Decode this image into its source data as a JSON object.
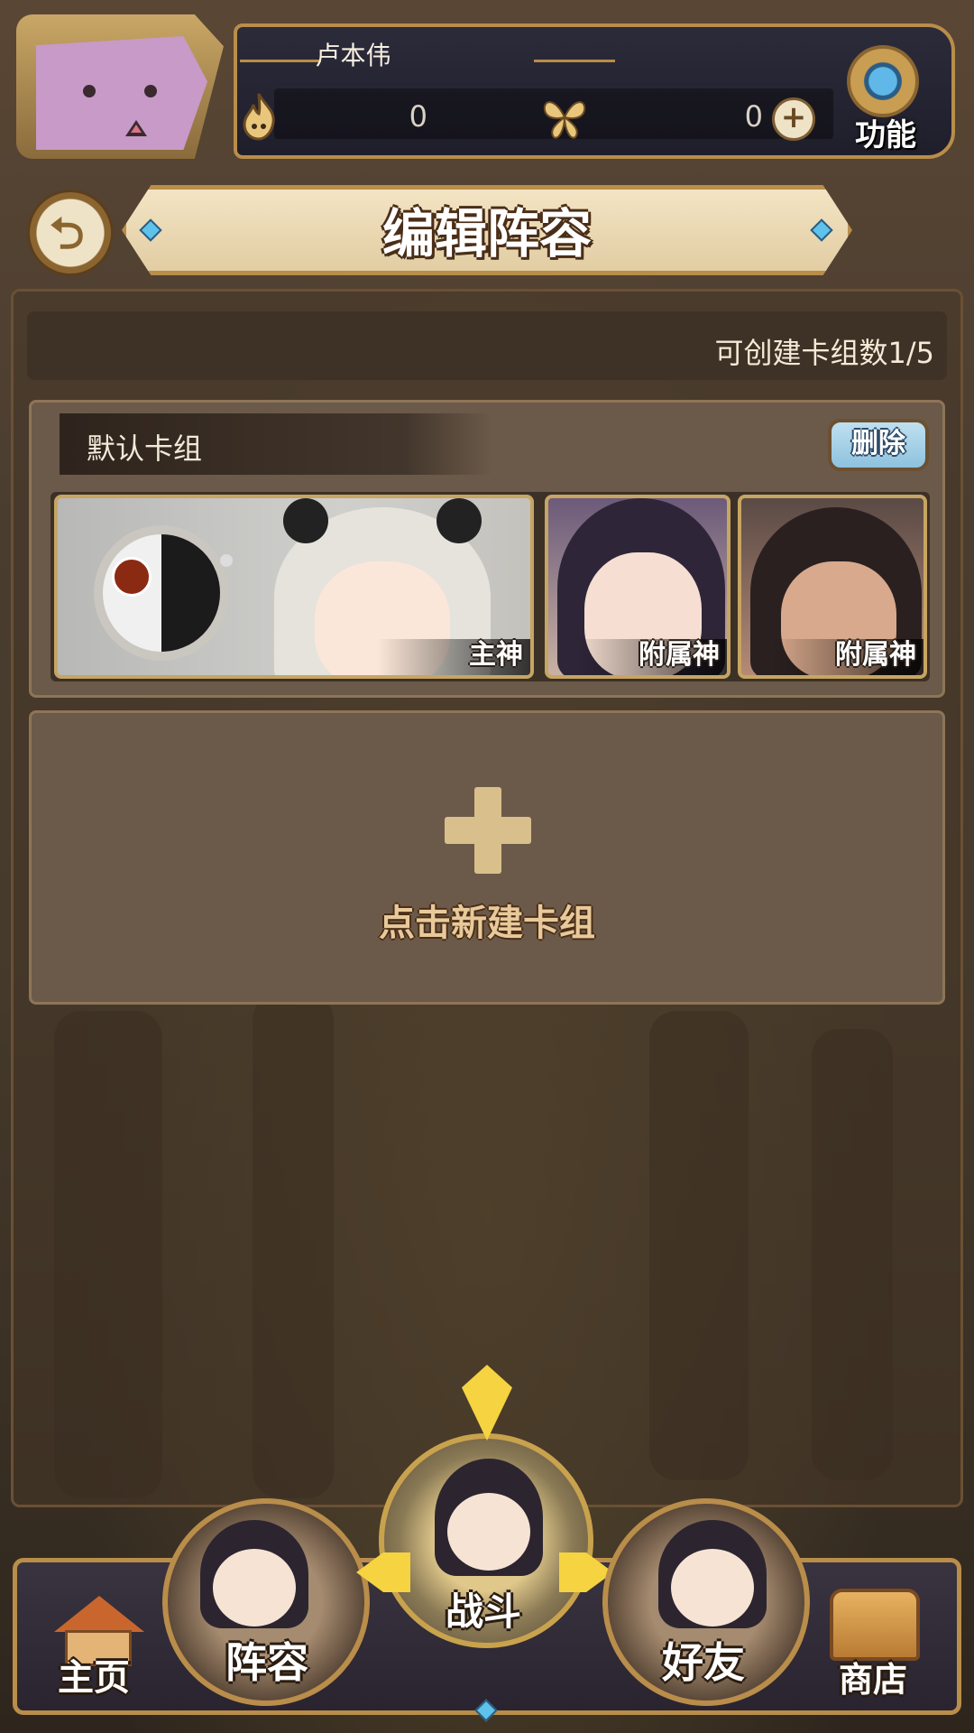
{
  "player": {
    "name": "卢本伟",
    "resource_a_value": "0",
    "resource_b_value": "0"
  },
  "header": {
    "function_label": "功能"
  },
  "title": {
    "text": "编辑阵容"
  },
  "deck_count": {
    "text": "可创建卡组数1/5"
  },
  "deck": {
    "name": "默认卡组",
    "delete_label": "删除",
    "slots": [
      {
        "label": "主神"
      },
      {
        "label": "附属神"
      },
      {
        "label": "附属神"
      }
    ]
  },
  "new_deck": {
    "label": "点击新建卡组"
  },
  "nav": {
    "items": [
      {
        "label": "主页"
      },
      {
        "label": "阵容"
      },
      {
        "label": "战斗"
      },
      {
        "label": "好友"
      },
      {
        "label": "商店"
      }
    ]
  },
  "colors": {
    "gold_frame": "#b98d4a",
    "panel_brown": "#6b5a49",
    "accent_blue": "#5fc2ea",
    "highlight_yellow": "#f5d341"
  }
}
